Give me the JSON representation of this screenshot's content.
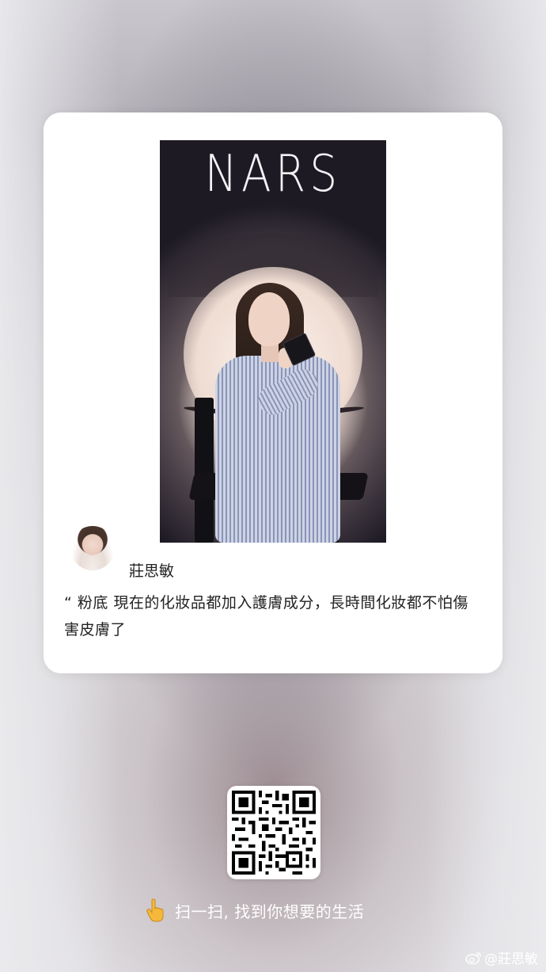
{
  "photo": {
    "logo_text": "NARS"
  },
  "author": {
    "name": "莊思敏"
  },
  "quote": {
    "text": "“ 粉底 現在的化妝品都加入護膚成分，長時間化妝都不怕傷害皮膚了"
  },
  "footer": {
    "hand_icon": "pointing-hand-icon",
    "tagline": "扫一扫, 找到你想要的生活"
  },
  "watermark": {
    "icon": "weibo-icon",
    "text": "@莊思敏"
  },
  "colors": {
    "card_bg": "#ffffff",
    "text_dark": "#222222",
    "footer_text": "#ffffff"
  }
}
